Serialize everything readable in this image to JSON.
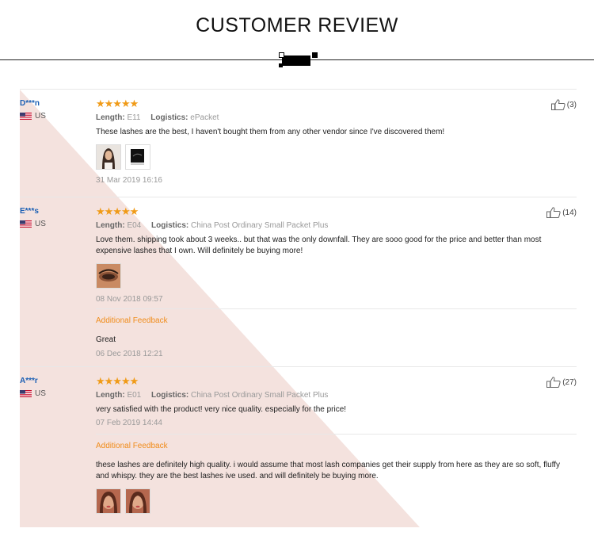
{
  "page": {
    "title": "CUSTOMER REVIEW"
  },
  "labels": {
    "length": "Length:",
    "logistics": "Logistics:",
    "additional_feedback": "Additional Feedback"
  },
  "colors": {
    "accent_orange": "#f09b18",
    "buyer_blue": "#1a5fb4",
    "background_tint": "#f4e2de"
  },
  "reviews": [
    {
      "buyer": "D***n",
      "country": "US",
      "stars": "★★★★★",
      "rating": 5,
      "length": "E11",
      "logistics": "ePacket",
      "text": "These lashes are the best, I haven't bought them from any other vendor since I've discovered them!",
      "photos": [
        "portrait-photo-icon",
        "lash-box-photo-icon"
      ],
      "date": "31 Mar 2019 16:16",
      "likes": "(3)"
    },
    {
      "buyer": "E***s",
      "country": "US",
      "stars": "★★★★★",
      "rating": 5,
      "length": "E04",
      "logistics": "China Post Ordinary Small Packet Plus",
      "text": "Love them. shipping took about 3 weeks.. but that was the only downfall. They are sooo good for the price and better than most expensive lashes that I own. Will definitely be buying more!",
      "photos": [
        "eye-closeup-photo-icon"
      ],
      "date": "08 Nov 2018 09:57",
      "additional": {
        "text": "Great",
        "date": "06 Dec 2018 12:21"
      },
      "likes": "(14)"
    },
    {
      "buyer": "A***r",
      "country": "US",
      "stars": "★★★★★",
      "rating": 5,
      "length": "E01",
      "logistics": "China Post Ordinary Small Packet Plus",
      "text": "very satisfied with the product! very nice quality. especially for the price!",
      "date": "07 Feb 2019 14:44",
      "additional": {
        "text": "these lashes are definitely high quality. i would assume that most lash companies get their supply from here as they are so soft, fluffy and whispy. they are the best lashes ive used. and will definitely be buying more.",
        "photos": [
          "face-photo-icon",
          "face-photo-icon"
        ]
      },
      "likes": "(27)"
    }
  ]
}
